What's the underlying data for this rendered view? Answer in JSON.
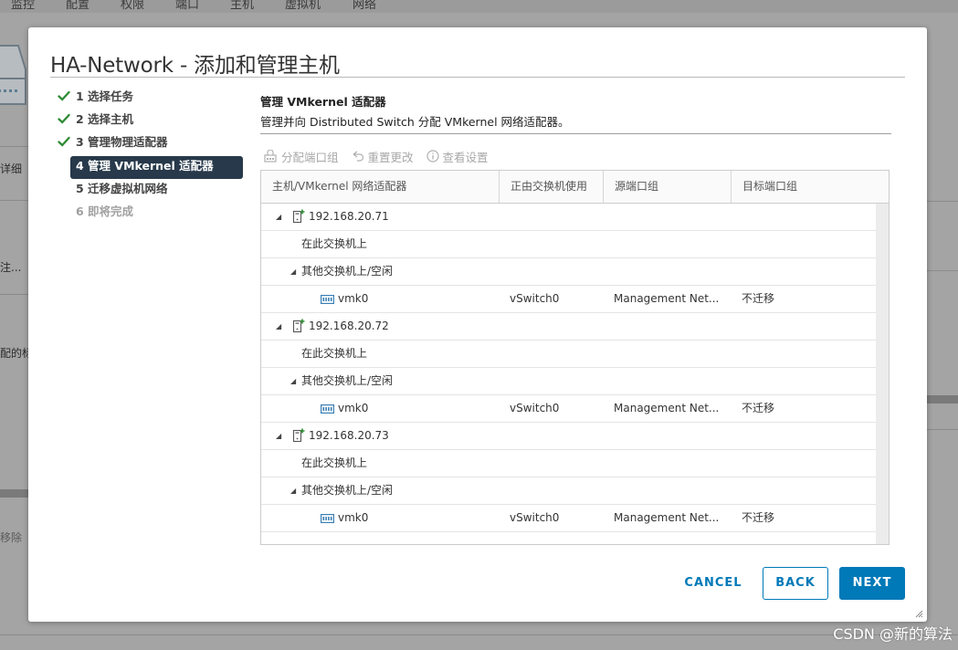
{
  "background": {
    "nav_items": [
      "监控",
      "配置",
      "权限",
      "端口",
      "主机",
      "虚拟机",
      "网络"
    ],
    "left_texts": [
      "详细",
      "注...",
      "配的标",
      "移除"
    ]
  },
  "dialog": {
    "title": "HA-Network - 添加和管理主机"
  },
  "steps": [
    {
      "label": "1 选择任务",
      "state": "done"
    },
    {
      "label": "2 选择主机",
      "state": "done"
    },
    {
      "label": "3 管理物理适配器",
      "state": "done"
    },
    {
      "label": "4 管理 VMkernel 适配器",
      "state": "active"
    },
    {
      "label": "5 迁移虚拟机网络",
      "state": "pending"
    },
    {
      "label": "6 即将完成",
      "state": "disabled"
    }
  ],
  "section": {
    "title": "管理 VMkernel 适配器",
    "description": "管理并向 Distributed Switch 分配 VMkernel 网络适配器。"
  },
  "toolbar": {
    "assign_label": "分配端口组",
    "reset_label": "重置更改",
    "view_label": "查看设置"
  },
  "grid": {
    "columns": [
      "主机/VMkernel 网络适配器",
      "正由交换机使用",
      "源端口组",
      "目标端口组"
    ],
    "hosts": [
      {
        "name": "192.168.20.71",
        "on_switch_label": "在此交换机上",
        "other_label": "其他交换机上/空闲",
        "adapter": {
          "name": "vmk0",
          "switch": "vSwitch0",
          "source": "Management Net...",
          "target": "不迁移"
        }
      },
      {
        "name": "192.168.20.72",
        "on_switch_label": "在此交换机上",
        "other_label": "其他交换机上/空闲",
        "adapter": {
          "name": "vmk0",
          "switch": "vSwitch0",
          "source": "Management Net...",
          "target": "不迁移"
        }
      },
      {
        "name": "192.168.20.73",
        "on_switch_label": "在此交换机上",
        "other_label": "其他交换机上/空闲",
        "adapter": {
          "name": "vmk0",
          "switch": "vSwitch0",
          "source": "Management Net...",
          "target": "不迁移"
        }
      }
    ]
  },
  "buttons": {
    "cancel": "CANCEL",
    "back": "BACK",
    "next": "NEXT"
  },
  "watermark": "CSDN @新的算法",
  "colors": {
    "accent": "#0079b8",
    "active_step_bg": "#27394a",
    "check_green": "#2e8b35"
  }
}
